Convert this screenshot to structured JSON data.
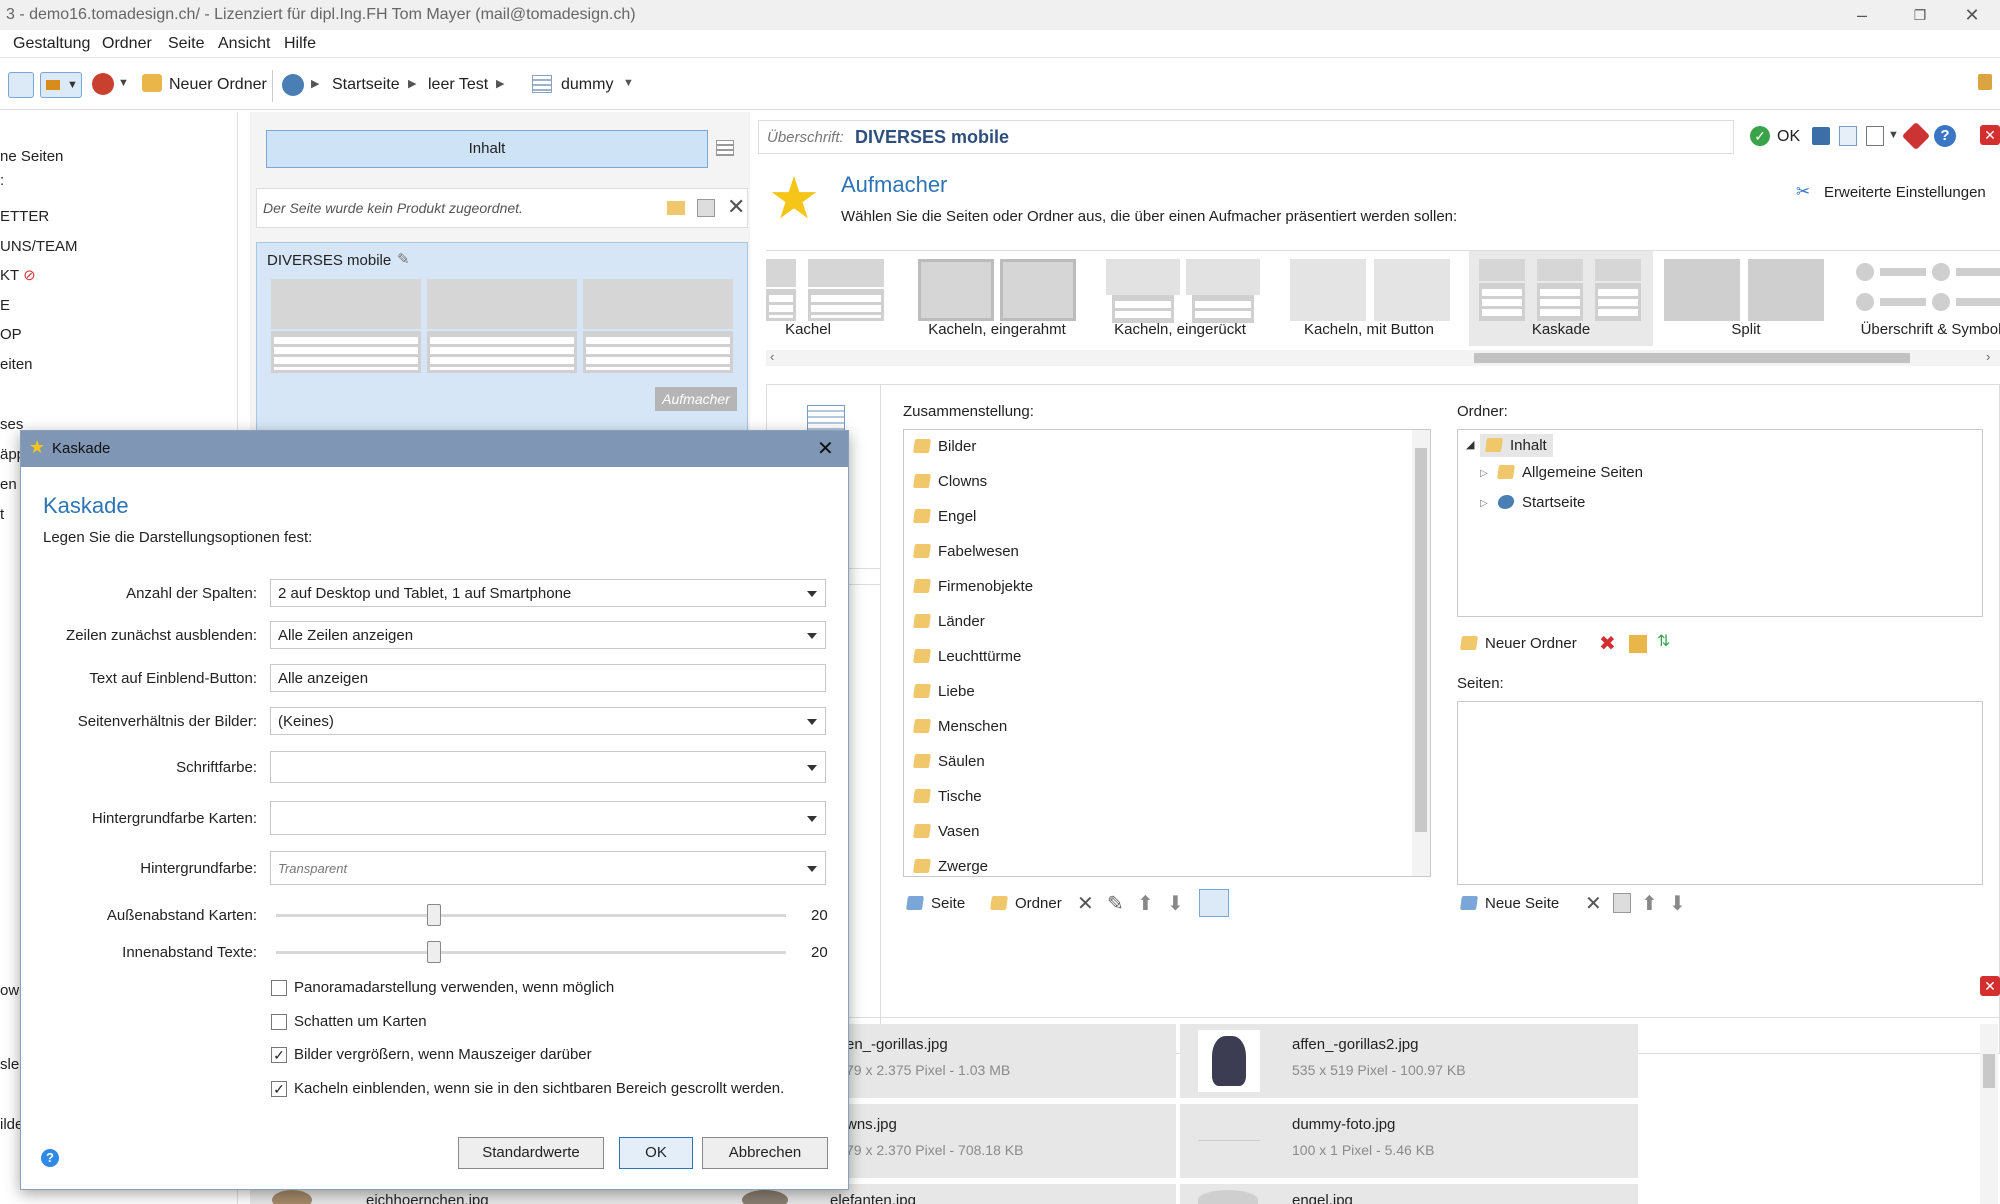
{
  "window": {
    "title_prefix": "3",
    "title": "demo16.tomadesign.ch/ - Lizenziert für dipl.Ing.FH Tom Mayer (mail@tomadesign.ch)"
  },
  "menu": [
    "Gestaltung",
    "Ordner",
    "Seite",
    "Ansicht",
    "Hilfe"
  ],
  "toolbar": {
    "new_folder": "Neuer Ordner",
    "breadcrumb": [
      "Startseite",
      "leer Test",
      "dummy"
    ]
  },
  "left_nav": [
    "ne Seiten",
    ":",
    "ETTER",
    "UNS/TEAM",
    "KT",
    "E",
    "OP",
    "eiten",
    "ses",
    "äpp",
    "en",
    "t",
    "ow",
    "sle",
    "ilde"
  ],
  "middle": {
    "content_button": "Inhalt",
    "no_product": "Der Seite wurde kein Produkt zugeordnet.",
    "card_title": "DIVERSES mobile",
    "card_badge": "Aufmacher"
  },
  "editor": {
    "heading_label": "Überschrift:",
    "heading_value": "DIVERSES mobile",
    "ok": "OK",
    "section_title": "Aufmacher",
    "section_desc": "Wählen Sie die Seiten oder Ordner aus, die über einen Aufmacher präsentiert werden sollen:",
    "advanced": "Erweiterte Einstellungen",
    "layouts": [
      "Kachel",
      "Kacheln, eingerahmt",
      "Kacheln, eingerückt",
      "Kacheln, mit Button",
      "Kaskade",
      "Split",
      "Überschrift & Symbol"
    ],
    "selected_layout": "Kaskade",
    "compilation_label": "Zusammenstellung:",
    "compilation": [
      "Bilder",
      "Clowns",
      "Engel",
      "Fabelwesen",
      "Firmenobjekte",
      "Länder",
      "Leuchttürme",
      "Liebe",
      "Menschen",
      "Säulen",
      "Tische",
      "Vasen",
      "Zwerge"
    ],
    "compilation_buttons": {
      "page": "Seite",
      "folder": "Ordner"
    },
    "folder_label": "Ordner:",
    "folders": {
      "root": "Inhalt",
      "children": [
        "Allgemeine Seiten",
        "Startseite"
      ]
    },
    "new_folder": "Neuer Ordner",
    "pages_label": "Seiten:",
    "new_page": "Neue Seite"
  },
  "files": [
    {
      "name": "en_-gorillas.jpg",
      "meta": "79 x 2.375 Pixel - 1.03 MB"
    },
    {
      "name": "affen_-gorillas2.jpg",
      "meta": "535 x 519 Pixel - 100.97 KB"
    },
    {
      "name": "wns.jpg",
      "meta": "79 x 2.370 Pixel - 708.18 KB"
    },
    {
      "name": "dummy-foto.jpg",
      "meta": "100 x 1 Pixel - 5.46 KB"
    },
    {
      "name": "eichhoernchen.jpg",
      "meta": ""
    },
    {
      "name": "elefanten.jpg",
      "meta": ""
    },
    {
      "name": "engel.jpg",
      "meta": ""
    }
  ],
  "dialog": {
    "window_title": "Kaskade",
    "title": "Kaskade",
    "subtitle": "Legen Sie die Darstellungsoptionen fest:",
    "fields": [
      {
        "label": "Anzahl der Spalten:",
        "value": "2 auf Desktop und Tablet, 1 auf Smartphone"
      },
      {
        "label": "Zeilen zunächst ausblenden:",
        "value": "Alle Zeilen anzeigen"
      },
      {
        "label": "Text auf Einblend-Button:",
        "value": "Alle anzeigen"
      },
      {
        "label": "Seitenverhältnis der Bilder:",
        "value": "(Keines)"
      },
      {
        "label": "Schriftfarbe:",
        "value": ""
      },
      {
        "label": "Hintergrundfarbe Karten:",
        "value": ""
      },
      {
        "label": "Hintergrundfarbe:",
        "value": "Transparent"
      }
    ],
    "sliders": [
      {
        "label": "Außenabstand Karten:",
        "value": "20",
        "level": 0.31
      },
      {
        "label": "Innenabstand Texte:",
        "value": "20",
        "level": 0.31
      }
    ],
    "checkboxes": [
      {
        "label": "Panoramadarstellung verwenden, wenn möglich",
        "checked": false
      },
      {
        "label": "Schatten um Karten",
        "checked": false
      },
      {
        "label": "Bilder vergrößern, wenn Mauszeiger darüber",
        "checked": true
      },
      {
        "label": "Kacheln einblenden, wenn sie in den sichtbaren Bereich gescrollt werden.",
        "checked": true
      }
    ],
    "buttons": {
      "defaults": "Standardwerte",
      "ok": "OK",
      "cancel": "Abbrechen"
    }
  },
  "colors": {
    "accent": "#2e74b5",
    "dialog_header": "#7f97b5",
    "selected": "#cfe3f7",
    "close_red": "#e03030"
  }
}
